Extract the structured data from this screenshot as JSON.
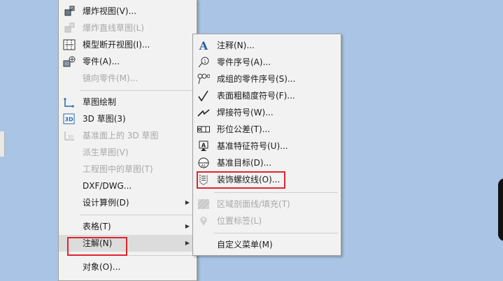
{
  "main_menu": {
    "items": [
      {
        "label": "爆炸视图(V)...",
        "icon": "exploded-view-icon",
        "disabled": false
      },
      {
        "label": "爆炸直线草图(L)",
        "icon": "explode-line-sketch-icon",
        "disabled": true
      },
      {
        "label": "模型断开视图(I)...",
        "icon": "broken-view-icon",
        "disabled": false
      },
      {
        "label": "零件(A)...",
        "icon": "part-icon",
        "disabled": false
      },
      {
        "label": "镜向零件(M)...",
        "icon": "",
        "disabled": true
      },
      {
        "label": "草图绘制",
        "icon": "sketch-icon",
        "disabled": false
      },
      {
        "label": "3D 草图(3)",
        "icon": "3d-sketch-icon",
        "disabled": false
      },
      {
        "label": "基准面上的 3D 草图",
        "icon": "3d-sketch-on-plane-icon",
        "disabled": true
      },
      {
        "label": "派生草图(V)",
        "icon": "",
        "disabled": true
      },
      {
        "label": "工程图中的草图(T)",
        "icon": "",
        "disabled": true
      },
      {
        "label": "DXF/DWG...",
        "icon": "",
        "disabled": false
      },
      {
        "label": "设计算例(D)",
        "icon": "",
        "disabled": false
      },
      {
        "label": "表格(T)",
        "icon": "",
        "disabled": false
      },
      {
        "label": "注解(N)",
        "icon": "",
        "disabled": false
      },
      {
        "label": "对象(O)...",
        "icon": "",
        "disabled": false
      }
    ]
  },
  "sub_menu": {
    "items": [
      {
        "label": "注释(N)...",
        "icon": "note-icon",
        "disabled": false
      },
      {
        "label": "零件序号(A)...",
        "icon": "balloon-icon",
        "disabled": false
      },
      {
        "label": "成组的零件序号(S)...",
        "icon": "stacked-balloon-icon",
        "disabled": false
      },
      {
        "label": "表面粗糙度符号(F)...",
        "icon": "surface-finish-icon",
        "disabled": false
      },
      {
        "label": "焊接符号(W)...",
        "icon": "weld-symbol-icon",
        "disabled": false
      },
      {
        "label": "形位公差(T)...",
        "icon": "geometric-tolerance-icon",
        "disabled": false
      },
      {
        "label": "基准特征符号(U)...",
        "icon": "datum-feature-icon",
        "disabled": false
      },
      {
        "label": "基准目标(D)...",
        "icon": "datum-target-icon",
        "disabled": false
      },
      {
        "label": "装饰螺纹线(O)...",
        "icon": "cosmetic-thread-icon",
        "disabled": false
      },
      {
        "label": "区域剖面线/填充(T)",
        "icon": "hatch-icon",
        "disabled": true
      },
      {
        "label": "位置标签(L)",
        "icon": "location-label-icon",
        "disabled": true
      },
      {
        "label": "自定义菜单(M)",
        "icon": "",
        "disabled": false
      }
    ]
  },
  "colors": {
    "highlight": "#e0262e",
    "desktop": "#a9c4e4",
    "menu_bg": "#f2f2f2"
  }
}
